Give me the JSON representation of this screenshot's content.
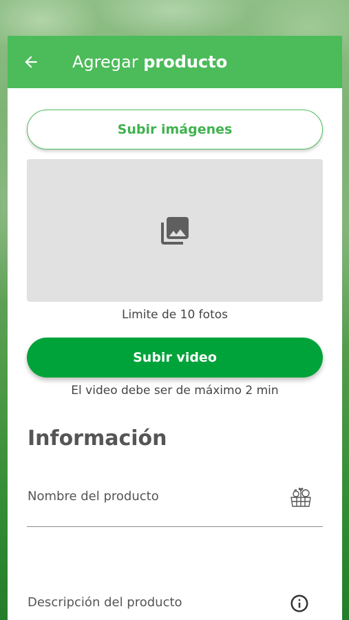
{
  "header": {
    "back_icon": "arrow-left-icon",
    "title_prefix": "Agregar",
    "title_bold": "producto"
  },
  "media": {
    "upload_images_label": "Subir imágenes",
    "placeholder_icon": "photo-library-icon",
    "photo_limit_text": "Limite de 10 fotos",
    "upload_video_label": "Subir video",
    "video_limit_text": "El video debe ser de máximo 2 min"
  },
  "info": {
    "section_title": "Información",
    "name_label": "Nombre del producto",
    "name_icon": "produce-basket-icon",
    "description_label": "Descripción del producto",
    "description_icon": "info-icon"
  },
  "colors": {
    "appbar": "#4cbb5a",
    "primary_button": "#00a33a",
    "outline_button_text": "#3fb24f"
  }
}
